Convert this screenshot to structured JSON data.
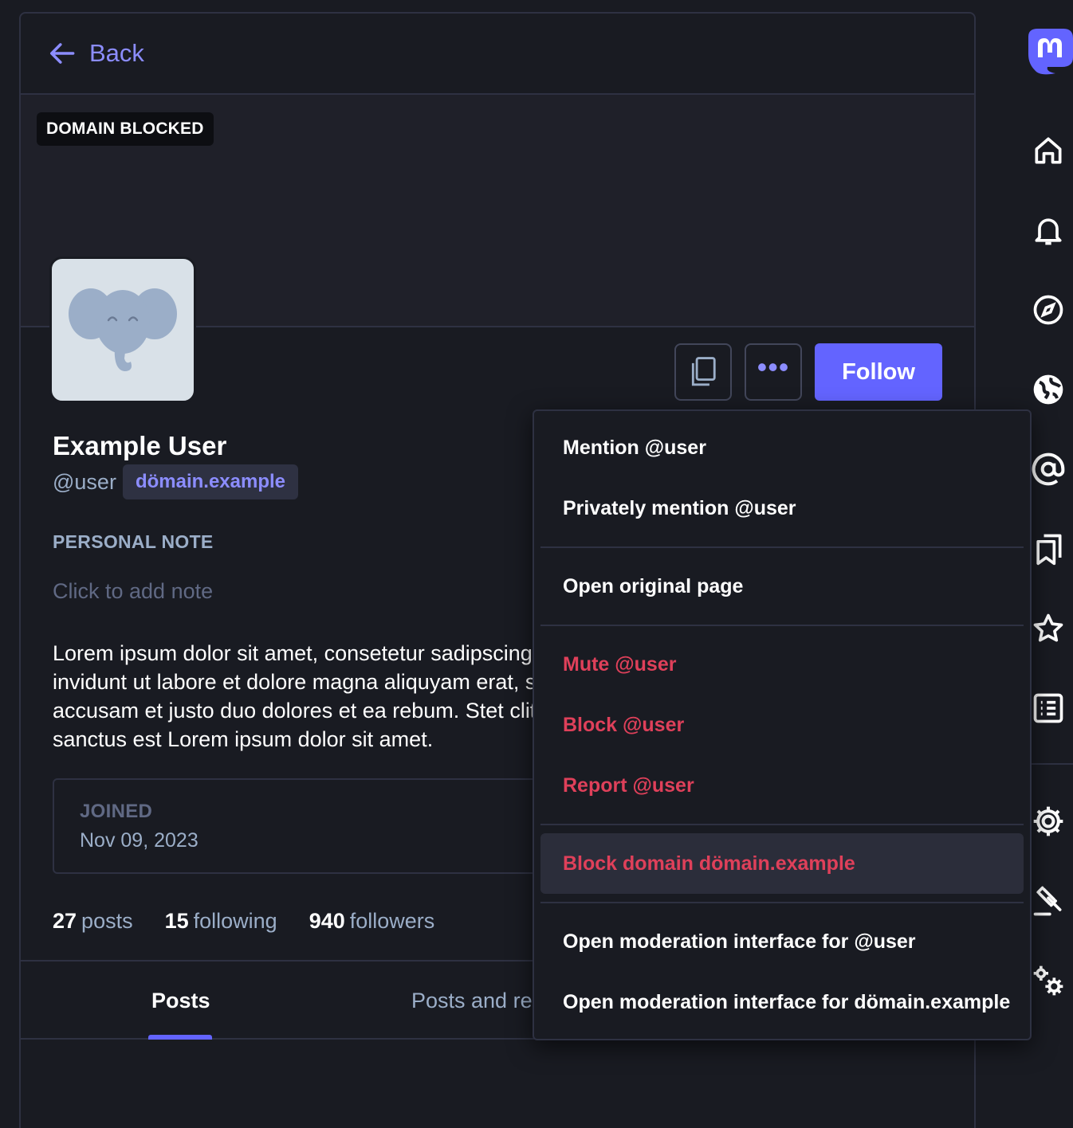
{
  "header": {
    "back_label": "Back"
  },
  "banner": {
    "badge": "DOMAIN BLOCKED"
  },
  "profile": {
    "display_name": "Example User",
    "handle": "@user",
    "domain": "dömain.example",
    "note_label": "PERSONAL NOTE",
    "note_placeholder": "Click to add note",
    "bio_lines": [
      "Lorem ipsum dolor sit amet, consetetur sadipscing elitr, sed diam nonumy eirmod tempor",
      "invidunt ut labore et dolore magna aliquyam erat, sed diam voluptua. At vero eos et",
      "accusam et justo duo dolores et ea rebum. Stet clita kasd gubergren, no sea takimata",
      "sanctus est Lorem ipsum dolor sit amet."
    ],
    "joined_label": "JOINED",
    "joined_date": "Nov 09, 2023",
    "counts": {
      "posts_num": "27",
      "posts_label": "posts",
      "following_num": "15",
      "following_label": "following",
      "followers_num": "940",
      "followers_label": "followers"
    }
  },
  "actions": {
    "follow_label": "Follow",
    "more_label": "•••"
  },
  "tabs": {
    "posts": "Posts",
    "posts_and_replies": "Posts and replies"
  },
  "menu": {
    "mention": "Mention @user",
    "private_mention": "Privately mention @user",
    "open_original": "Open original page",
    "mute": "Mute @user",
    "block": "Block @user",
    "report": "Report @user",
    "block_domain": "Block domain dömain.example",
    "mod_user": "Open moderation interface for @user",
    "mod_domain": "Open moderation interface for dömain.example"
  },
  "colors": {
    "accent": "#6364ff",
    "link": "#8c8dff",
    "danger": "#df405a",
    "background": "#191b22"
  },
  "nav_icons": [
    "mastodon-logo",
    "home-icon",
    "bell-icon",
    "compass-icon",
    "globe-icon",
    "at-icon",
    "bookmarks-icon",
    "star-icon",
    "list-icon",
    "gear-icon",
    "gavel-icon",
    "cogs-icon"
  ]
}
